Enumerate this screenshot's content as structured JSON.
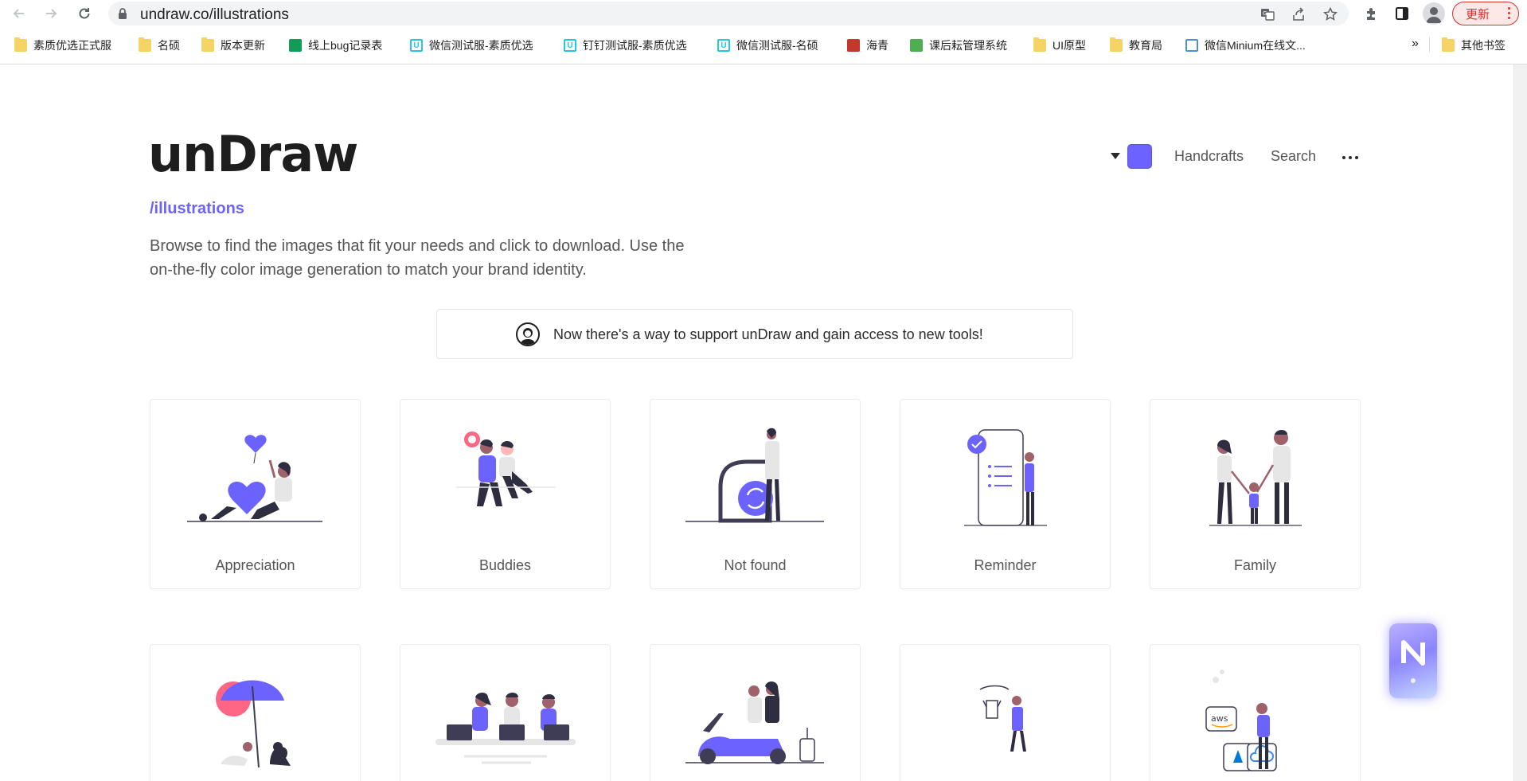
{
  "browser": {
    "url": "undraw.co/illustrations",
    "update_label": "更新",
    "bookmarks": [
      {
        "label": "素质优选正式服",
        "icon": "folder-icon"
      },
      {
        "label": "名硕",
        "icon": "folder-icon"
      },
      {
        "label": "版本更新",
        "icon": "folder-icon"
      },
      {
        "label": "线上bug记录表",
        "icon": "sheet-icon"
      },
      {
        "label": "微信测试服-素质优选",
        "icon": "u-icon"
      },
      {
        "label": "钉钉测试服-素质优选",
        "icon": "u-icon"
      },
      {
        "label": "微信测试服-名硕",
        "icon": "u-icon"
      },
      {
        "label": "海青",
        "icon": "site-icon"
      },
      {
        "label": "课后耘管理系统",
        "icon": "green-icon"
      },
      {
        "label": "UI原型",
        "icon": "folder-icon"
      },
      {
        "label": "教育局",
        "icon": "folder-icon"
      },
      {
        "label": "微信Minium在线文...",
        "icon": "mini-icon"
      }
    ],
    "more_bookmarks": "»",
    "other_bookmarks": "其他书签"
  },
  "header": {
    "logo": "unDraw",
    "subroute": "/illustrations",
    "intro": "Browse to find the images that fit your needs and click to download. Use the on-the-fly color image generation to match your brand identity.",
    "accent_color": "#6c63ff",
    "nav": {
      "handcrafts": "Handcrafts",
      "search": "Search"
    }
  },
  "banner": {
    "text": "Now there's a way to support unDraw and gain access to new tools!"
  },
  "illustrations": [
    {
      "label": "Appreciation"
    },
    {
      "label": "Buddies"
    },
    {
      "label": "Not found"
    },
    {
      "label": "Reminder"
    },
    {
      "label": "Family"
    }
  ],
  "illustrations_row2": [
    {
      "label": ""
    },
    {
      "label": ""
    },
    {
      "label": ""
    },
    {
      "label": ""
    },
    {
      "label": "",
      "badges": [
        "aws"
      ]
    }
  ]
}
